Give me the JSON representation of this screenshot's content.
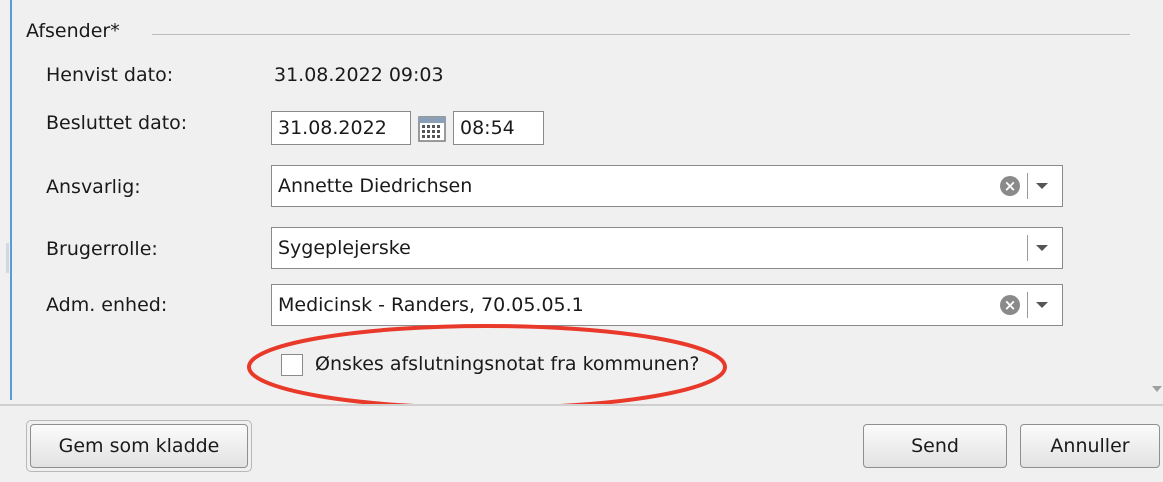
{
  "group": {
    "title": "Afsender*"
  },
  "fields": {
    "henvist": {
      "label": "Henvist dato:",
      "value": "31.08.2022 09:03"
    },
    "besluttet": {
      "label": "Besluttet dato:",
      "date": "31.08.2022",
      "time": "08:54"
    },
    "ansvarlig": {
      "label": "Ansvarlig:",
      "value": "Annette Diedrichsen"
    },
    "brugerrolle": {
      "label": "Brugerrolle:",
      "value": "Sygeplejerske"
    },
    "adm_enhed": {
      "label": "Adm. enhed:",
      "value": "Medicinsk - Randers, 70.05.05.1"
    }
  },
  "checkbox": {
    "label": "Ønskes afslutningsnotat fra kommunen?",
    "checked": false
  },
  "buttons": {
    "draft": "Gem som kladde",
    "send": "Send",
    "cancel": "Annuller"
  },
  "icons": {
    "calendar": "calendar-icon",
    "clear": "clear-icon",
    "dropdown": "chevron-down-icon"
  },
  "colors": {
    "highlight": "#e8392b",
    "accent_border": "#5a9bd5"
  }
}
